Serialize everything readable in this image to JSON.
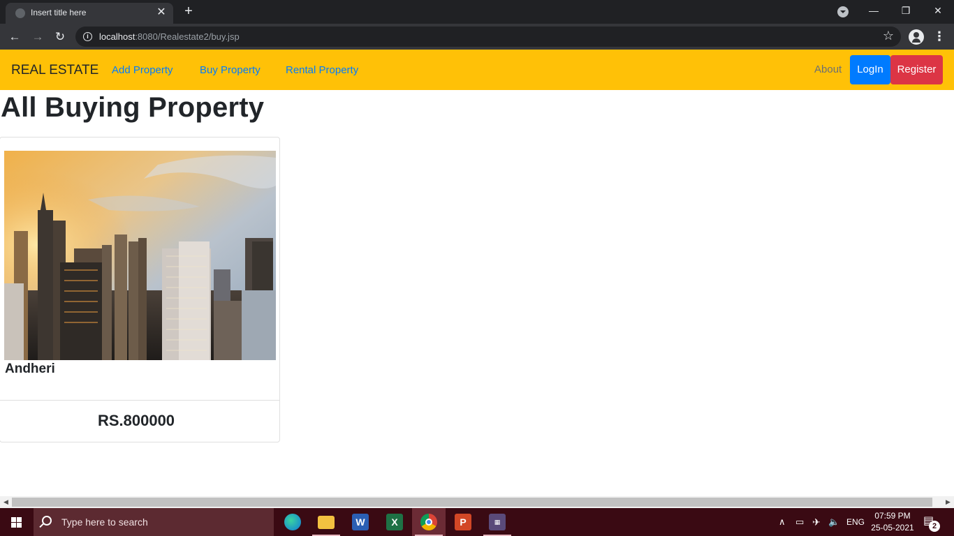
{
  "browser": {
    "tab_title": "Insert title here",
    "url_host": "localhost",
    "url_rest": ":8080/Realestate2/buy.jsp"
  },
  "navbar": {
    "brand": "REAL ESTATE",
    "links": [
      "Add Property",
      "Buy Property",
      "Rental Property"
    ],
    "about": "About",
    "login": "LogIn",
    "register": "Register",
    "colors": {
      "bar": "#ffc107",
      "link": "#007bff",
      "login": "#007bff",
      "register": "#dc3545"
    }
  },
  "page": {
    "title": "All Buying Property",
    "card": {
      "location": "Andheri",
      "price": "RS.800000",
      "image": "city-skyline-sunset"
    }
  },
  "taskbar": {
    "search_placeholder": "Type here to search",
    "language": "ENG",
    "time": "07:59 PM",
    "date": "25-05-2021",
    "notification_count": "2",
    "apps": [
      "edge-icon",
      "file-explorer-icon",
      "word-icon",
      "excel-icon",
      "chrome-icon",
      "powerpoint-icon",
      "app-icon"
    ]
  }
}
